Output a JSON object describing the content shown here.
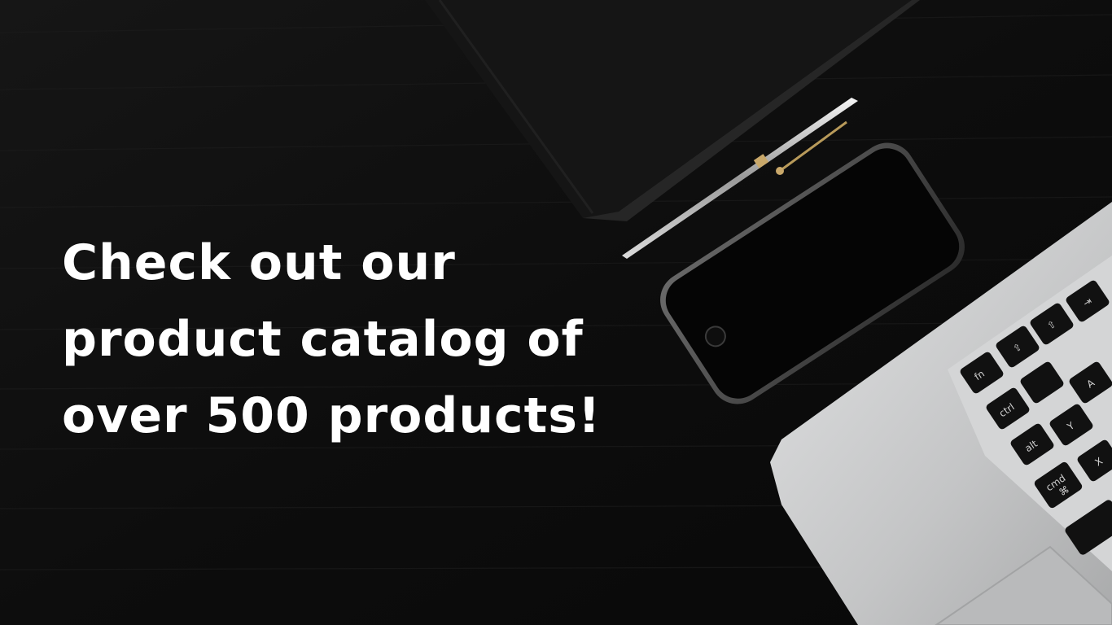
{
  "headline": {
    "lines": [
      "Check out our",
      "product catalog of",
      "over 500 products!"
    ]
  },
  "keyboard": {
    "keys": [
      "fn",
      "ctrl",
      "alt",
      "cmd",
      "⌘",
      "A",
      "Y",
      "X"
    ]
  },
  "colors": {
    "background": "#0b0b0b",
    "text": "#ffffff",
    "laptop": "#c9cacb",
    "notebook": "#141414"
  }
}
